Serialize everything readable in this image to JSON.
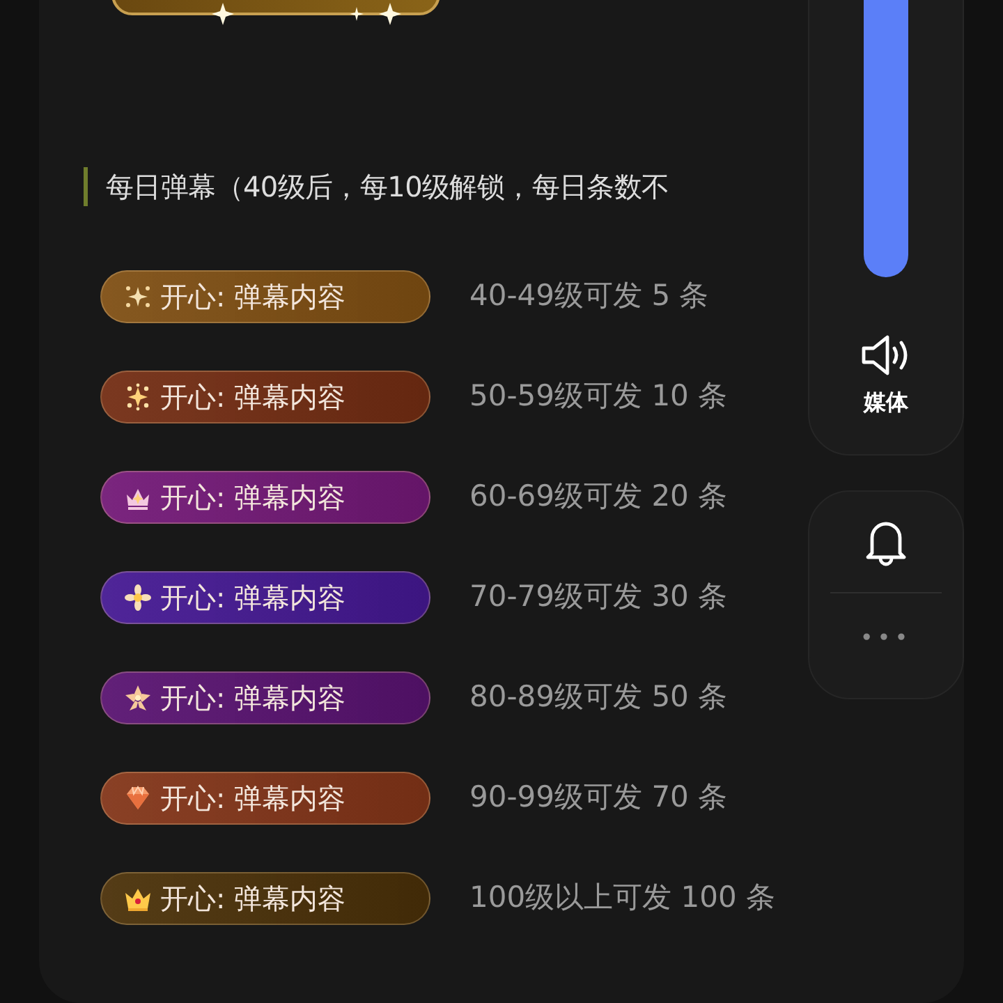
{
  "heading": "每日弹幕（40级后，每10级解锁，每日条数不",
  "tiers": [
    {
      "kind": "sparkle",
      "badge": "开心: 弹幕内容",
      "color": "#7e4e12",
      "rule": "40-49级可发 5 条"
    },
    {
      "kind": "burst",
      "badge": "开心: 弹幕内容",
      "color": "#722c12",
      "rule": "50-59级可发 10 条"
    },
    {
      "kind": "crown-sparkle",
      "badge": "开心: 弹幕内容",
      "color": "#721876",
      "rule": "60-69级可发 20 条"
    },
    {
      "kind": "flower",
      "badge": "开心: 弹幕内容",
      "color": "#441892",
      "rule": "70-79级可发 30 条"
    },
    {
      "kind": "star-flower",
      "badge": "开心: 弹幕内容",
      "color": "#581270",
      "rule": "80-89级可发 50 条"
    },
    {
      "kind": "diamond",
      "badge": "开心: 弹幕内容",
      "color": "#823418",
      "rule": "90-99级可发 70 条"
    },
    {
      "kind": "crown",
      "badge": "开心: 弹幕内容",
      "color": "#4a3008",
      "rule": "100级以上可发 100 条"
    }
  ],
  "volume_panel": {
    "label": "媒体"
  },
  "more_panel": {
    "more": "•••"
  }
}
